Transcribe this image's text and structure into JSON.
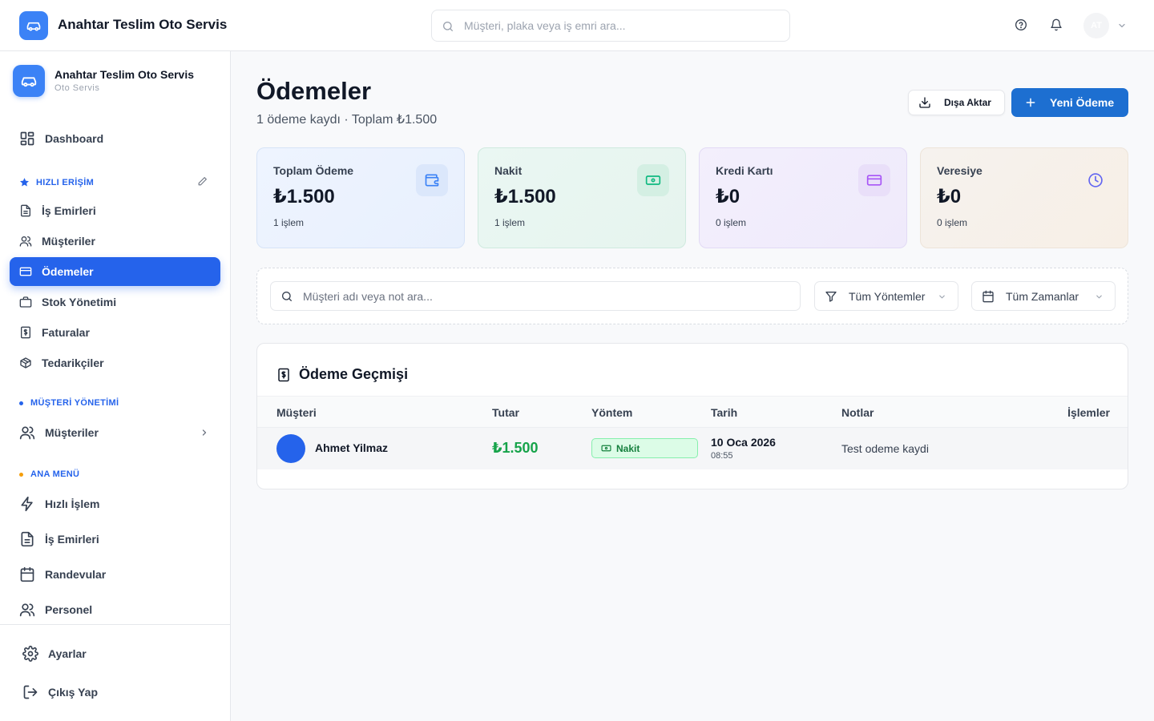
{
  "topbar": {
    "brand": "Anahtar Teslim Oto Servis",
    "search_placeholder": "Müşteri, plaka veya iş emri ara...",
    "avatar_initials": "AT"
  },
  "sidebar": {
    "brand": "Anahtar Teslim Oto Servis",
    "subtitle": "Oto Servis",
    "dashboard": "Dashboard",
    "quick_access": {
      "title": "HIZLI ERİŞİM",
      "items": [
        "İş Emirleri",
        "Müşteriler",
        "Ödemeler",
        "Stok Yönetimi",
        "Faturalar",
        "Tedarikçiler"
      ]
    },
    "customer_mgmt": {
      "title": "MÜŞTERİ YÖNETİMİ",
      "items": [
        "Müşteriler"
      ]
    },
    "main_menu": {
      "title": "ANA MENÜ",
      "items": [
        "Hızlı İşlem",
        "İş Emirleri",
        "Randevular",
        "Personel"
      ]
    },
    "settings": "Ayarlar",
    "logout": "Çıkış Yap"
  },
  "page": {
    "title": "Ödemeler",
    "subtitle": "1 ödeme kaydı · Toplam ₺1.500",
    "export_label": "Dışa Aktar",
    "new_label": "Yeni Ödeme"
  },
  "stats": [
    {
      "label": "Toplam Ödeme",
      "value": "₺1.500",
      "count": "1 işlem",
      "icon": "wallet-icon",
      "color": "#3b82f6"
    },
    {
      "label": "Nakit",
      "value": "₺1.500",
      "count": "1 işlem",
      "icon": "banknote-icon",
      "color": "#10b981"
    },
    {
      "label": "Kredi Kartı",
      "value": "₺0",
      "count": "0 işlem",
      "icon": "credit-card-icon",
      "color": "#a855f7"
    },
    {
      "label": "Veresiye",
      "value": "₺0",
      "count": "0 işlem",
      "icon": "clock-icon",
      "color": "#6366f1"
    }
  ],
  "filters": {
    "search_placeholder": "Müşteri adı veya not ara...",
    "method": "Tüm Yöntemler",
    "time": "Tüm Zamanlar"
  },
  "history": {
    "title": "Ödeme Geçmişi",
    "columns": [
      "Müşteri",
      "Tutar",
      "Yöntem",
      "Tarih",
      "Notlar",
      "İşlemler"
    ],
    "rows": [
      {
        "customer": "Ahmet Yilmaz",
        "amount": "₺1.500",
        "method": "Nakit",
        "date": "10 Oca 2026",
        "time": "08:55",
        "note": "Test odeme kaydi"
      }
    ]
  },
  "colors": {
    "primary": "#2563eb",
    "success": "#16a34a",
    "quick_dot": "#2563eb",
    "customer_dot": "#2563eb",
    "menu_dot": "#f59e0b"
  }
}
